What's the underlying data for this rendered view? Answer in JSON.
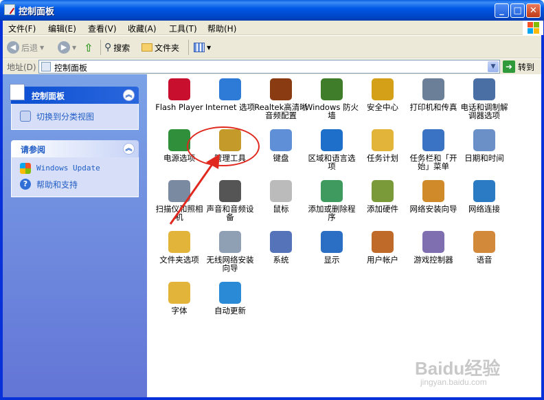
{
  "window": {
    "title": "控制面板"
  },
  "menu": [
    "文件(F)",
    "编辑(E)",
    "查看(V)",
    "收藏(A)",
    "工具(T)",
    "帮助(H)"
  ],
  "toolbar": {
    "back": "后退",
    "search": "搜索",
    "folders": "文件夹"
  },
  "address": {
    "label": "地址(D)",
    "value": "控制面板",
    "go": "转到"
  },
  "left": {
    "panel1_title": "控制面板",
    "panel1_link": "切换到分类视图",
    "panel2_title": "请参阅",
    "panel2_links": [
      "Windows Update",
      "帮助和支持"
    ]
  },
  "items": [
    "Flash Player",
    "Internet 选项",
    "Realtek高清晰音频配置",
    "Windows 防火墙",
    "安全中心",
    "打印机和传真",
    "电话和调制解调器选项",
    "电源选项",
    "管理工具",
    "键盘",
    "区域和语言选项",
    "任务计划",
    "任务栏和「开始」菜单",
    "日期和时间",
    "扫描仪和照相机",
    "声音和音频设备",
    "鼠标",
    "添加或删除程序",
    "添加硬件",
    "网络安装向导",
    "网络连接",
    "文件夹选项",
    "无线网络安装向导",
    "系统",
    "显示",
    "用户帐户",
    "游戏控制器",
    "语音",
    "字体",
    "自动更新"
  ],
  "icons": [
    "flash-icon",
    "internet-options-icon",
    "audio-speaker-icon",
    "firewall-icon",
    "security-shield-icon",
    "printer-icon",
    "phone-modem-icon",
    "power-icon",
    "admin-tools-icon",
    "keyboard-icon",
    "globe-icon",
    "scheduled-tasks-icon",
    "taskbar-icon",
    "clock-icon",
    "scanner-icon",
    "sound-icon",
    "mouse-icon",
    "add-remove-programs-icon",
    "add-hardware-icon",
    "network-setup-icon",
    "network-connections-icon",
    "folder-options-icon",
    "wireless-icon",
    "system-icon",
    "display-icon",
    "user-accounts-icon",
    "game-controller-icon",
    "speech-icon",
    "fonts-icon",
    "auto-update-icon"
  ],
  "colors": {
    "titlebar": "#0058e6",
    "link": "#215dc6",
    "annotation": "#e0281e"
  },
  "watermark": {
    "brand": "Baidu经验",
    "url": "jingyan.baidu.com"
  }
}
